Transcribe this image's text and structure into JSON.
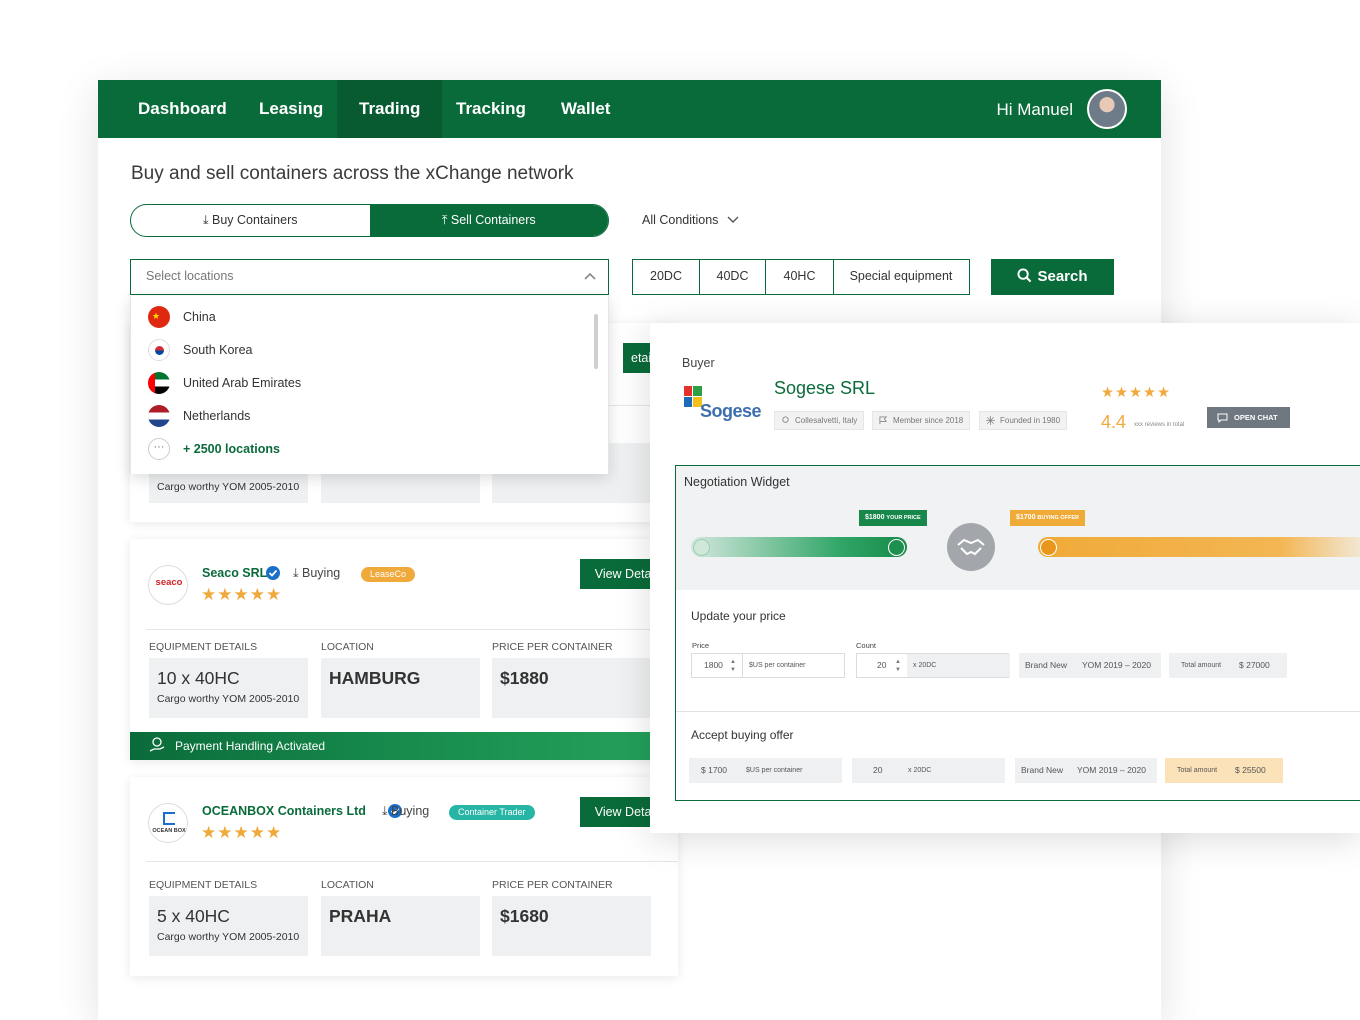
{
  "nav": {
    "items": [
      "Dashboard",
      "Leasing",
      "Trading",
      "Tracking",
      "Wallet"
    ],
    "active": "Trading",
    "greeting": "Hi Manuel"
  },
  "headline": "Buy and sell containers across the xChange network",
  "toggle": {
    "buy_label": "Buy Containers",
    "sell_label": "Sell Containers",
    "selected": "Sell Containers"
  },
  "conditions": "All Conditions",
  "locations": {
    "placeholder": "Select locations",
    "items": [
      "China",
      "South Korea",
      "United Arab Emirates",
      "Netherlands"
    ],
    "more": "+ 2500 locations"
  },
  "equipment": [
    "20DC",
    "40DC",
    "40HC",
    "Special equipment"
  ],
  "search_label": "Search",
  "card0": {
    "details_partial": "etails",
    "subtext": "Cargo worthy YOM 2005-2010"
  },
  "card1": {
    "logo_text": "seaco",
    "company": "Seaco SRL",
    "role": "Buying",
    "tag": "LeaseCo",
    "stars": "★★★★★",
    "view_label": "View Details",
    "headers": [
      "EQUIPMENT DETAILS",
      "LOCATION",
      "PRICE PER CONTAINER"
    ],
    "equipment": "10 x 40HC",
    "subtext": "Cargo worthy YOM 2005-2010",
    "location": "HAMBURG",
    "price": "$1880"
  },
  "payment_bar": "Payment Handling Activated",
  "card2": {
    "logo_text": "OCEAN BOX",
    "company": "OCEANBOX Containers Ltd",
    "role": "Buying",
    "tag": "Container Trader",
    "stars": "★★★★★",
    "view_label": "View Details",
    "headers": [
      "EQUIPMENT DETAILS",
      "LOCATION",
      "PRICE PER CONTAINER"
    ],
    "equipment": "5 x 40HC",
    "subtext": "Cargo worthy YOM 2005-2010",
    "location": "PRAHA",
    "price": "$1680"
  },
  "buyer": {
    "label": "Buyer",
    "logo_text": "Sogese",
    "name": "Sogese SRL",
    "location": "Collesalvetti, Italy",
    "member": "Member since 2018",
    "founded": "Founded in 1980",
    "stars": "★★★★★",
    "rating": "4.4",
    "reviews": "xxx reviews in total",
    "chat_label": "OPEN CHAT"
  },
  "negotiation": {
    "title": "Negotiation Widget",
    "your_price": "$1800",
    "your_price_label": "YOUR PRICE",
    "offer_price": "$1700",
    "offer_label": "BUYING OFFER",
    "update_label": "Update your price",
    "price_label": "Price",
    "price_value": "1800",
    "price_unit": "$US per container",
    "count_label": "Count",
    "count_value": "20",
    "count_unit": "x 20DC",
    "condition": "Brand New",
    "yom": "YOM 2019 – 2020",
    "total_label": "Total amount",
    "total_value": "$ 27000",
    "accept_label": "Accept buying offer",
    "offer_price_value": "$ 1700",
    "offer_unit": "$US per container",
    "offer_count": "20",
    "offer_count_unit": "x 20DC",
    "offer_condition": "Brand New",
    "offer_yom": "YOM 2019 – 2020",
    "offer_total_label": "Total amount",
    "offer_total_value": "$ 25500"
  },
  "colors": {
    "brand": "#0a6b3a",
    "accent": "#f0aa38",
    "verified": "#1a6fc9",
    "tag_teal": "#27b6a6"
  }
}
